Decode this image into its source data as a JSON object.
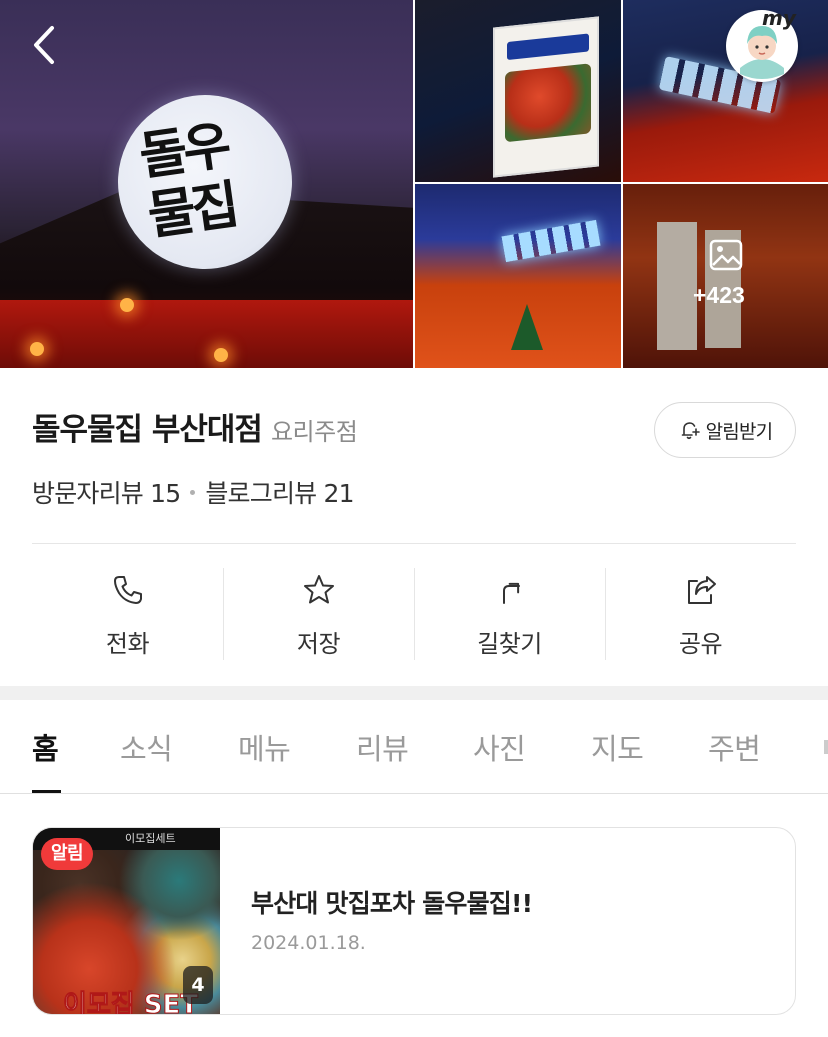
{
  "header": {
    "back_icon": "chevron-left-icon",
    "my_label": "my",
    "my_icon": "avatar-icon"
  },
  "gallery": {
    "main_sign_text": "돌우물집",
    "photo_more_count": "+423",
    "photo_icon": "image-icon"
  },
  "place": {
    "name": "돌우물집 부산대점",
    "category": "요리주점",
    "alarm_label": "알림받기",
    "alarm_icon": "bell-plus-icon",
    "visitor_review_label": "방문자리뷰 15",
    "blog_review_label": "블로그리뷰 21"
  },
  "actions": [
    {
      "label": "전화",
      "icon": "phone-icon"
    },
    {
      "label": "저장",
      "icon": "star-icon"
    },
    {
      "label": "길찾기",
      "icon": "directions-arrow-icon"
    },
    {
      "label": "공유",
      "icon": "share-icon"
    }
  ],
  "tabs": [
    {
      "label": "홈",
      "active": true
    },
    {
      "label": "소식",
      "active": false
    },
    {
      "label": "메뉴",
      "active": false
    },
    {
      "label": "리뷰",
      "active": false
    },
    {
      "label": "사진",
      "active": false
    },
    {
      "label": "지도",
      "active": false
    },
    {
      "label": "주변",
      "active": false
    }
  ],
  "news": {
    "badge": "알림",
    "image_count": "4",
    "title": "부산대 맛집포차 돌우물집!!",
    "date": "2024.01.18.",
    "thumb_top_text": "이모집세트",
    "thumb_set_text": "이모집 SET"
  },
  "colors": {
    "accent_red": "#f03a3a",
    "text_primary": "#1a1a1a",
    "text_secondary": "#8b8b8b",
    "divider": "#e6e6e6",
    "band": "#f0f0f0"
  }
}
